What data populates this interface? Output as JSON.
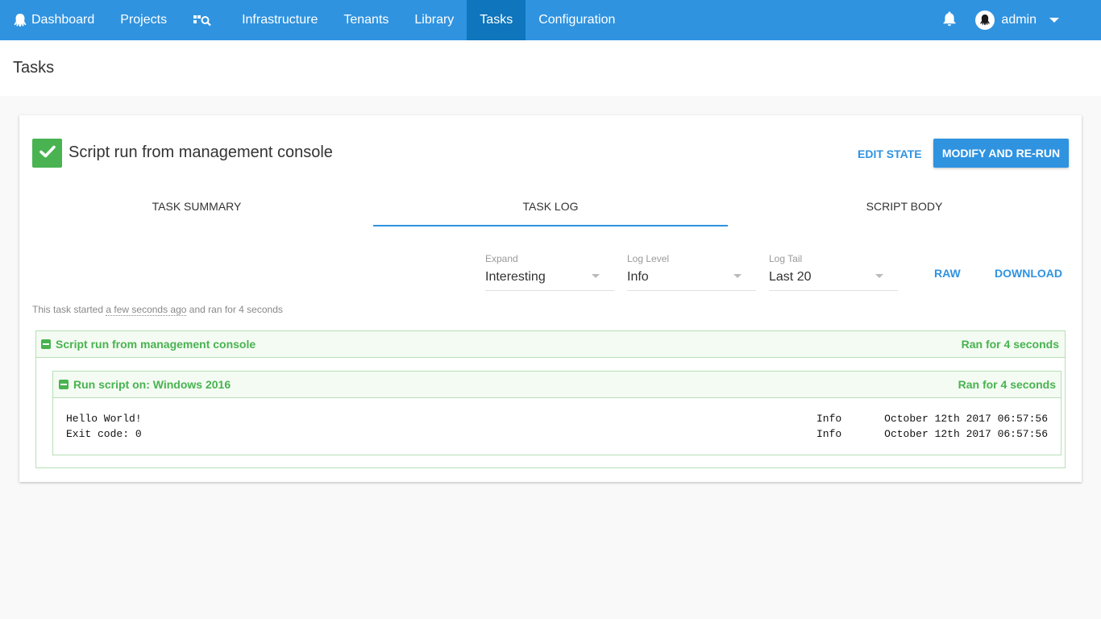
{
  "nav": {
    "items": [
      {
        "label": "Dashboard",
        "icon": "octopus-icon"
      },
      {
        "label": "Projects"
      },
      {
        "label": "",
        "icon": "project-search-icon"
      },
      {
        "label": "Infrastructure"
      },
      {
        "label": "Tenants"
      },
      {
        "label": "Library"
      },
      {
        "label": "Tasks",
        "active": true
      },
      {
        "label": "Configuration"
      }
    ],
    "user": "admin",
    "colors": {
      "bar": "#2f93e0",
      "active": "#0f75bc"
    }
  },
  "page": {
    "title": "Tasks"
  },
  "task": {
    "title": "Script run from management console",
    "status": "success",
    "status_color": "#48b350",
    "edit_state_label": "EDIT STATE",
    "rerun_label": "MODIFY AND RE-RUN"
  },
  "tabs": [
    {
      "label": "TASK SUMMARY"
    },
    {
      "label": "TASK LOG",
      "active": true
    },
    {
      "label": "SCRIPT BODY"
    }
  ],
  "filters": {
    "expand": {
      "label": "Expand",
      "value": "Interesting"
    },
    "log_level": {
      "label": "Log Level",
      "value": "Info"
    },
    "log_tail": {
      "label": "Log Tail",
      "value": "Last 20"
    },
    "raw_label": "RAW",
    "download_label": "DOWNLOAD"
  },
  "started": {
    "prefix": "This task started ",
    "ago": "a few seconds ago",
    "suffix": " and ran for 4 seconds"
  },
  "log": {
    "title": "Script run from management console",
    "duration": "Ran for 4 seconds",
    "child": {
      "title": "Run script on: Windows 2016",
      "duration": "Ran for 4 seconds",
      "lines": [
        {
          "message": "Hello World!",
          "level": "Info",
          "timestamp": "October 12th 2017 06:57:56"
        },
        {
          "message": "Exit code: 0",
          "level": "Info",
          "timestamp": "October 12th 2017 06:57:56"
        }
      ]
    }
  }
}
